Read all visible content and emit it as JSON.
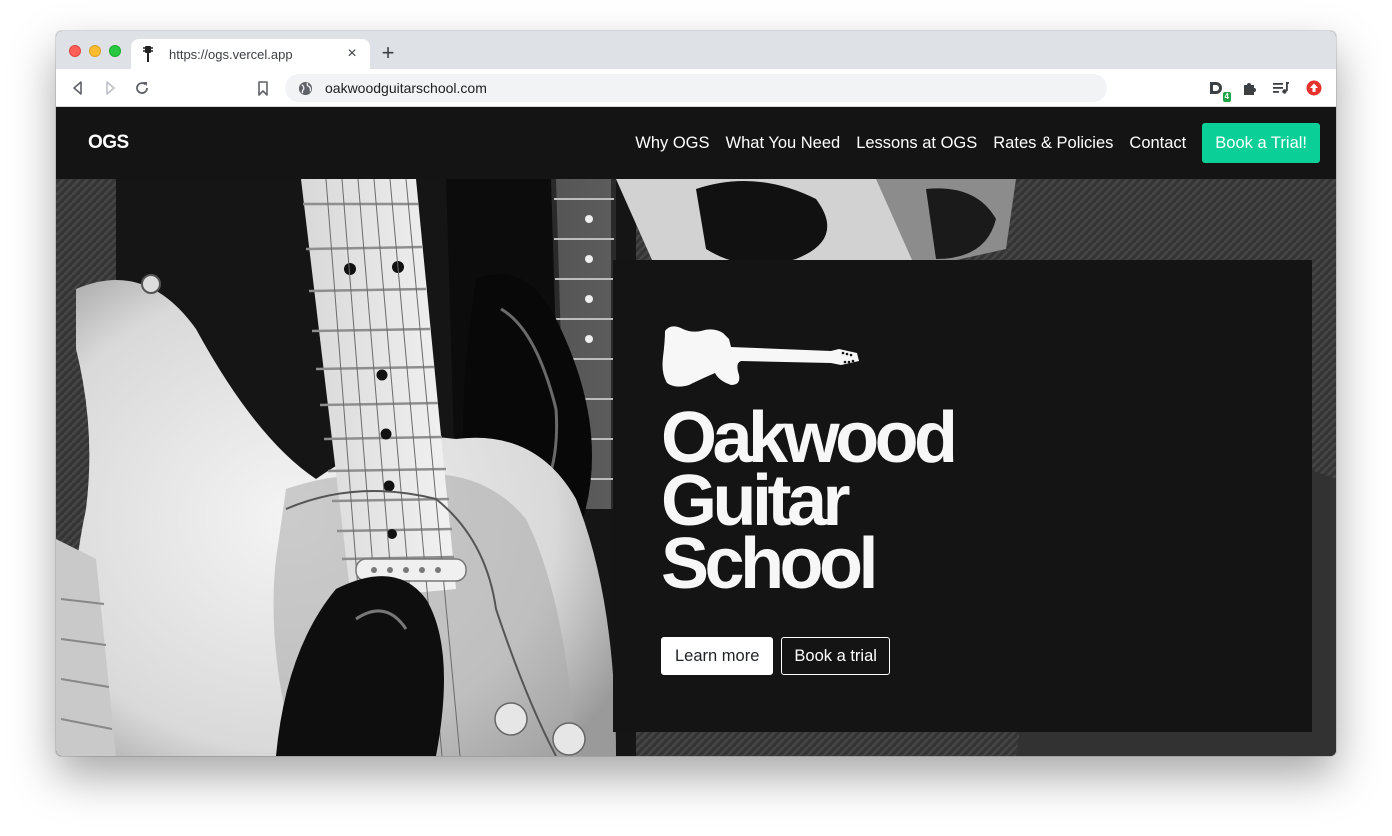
{
  "browser": {
    "tab": {
      "title": "https://ogs.vercel.app",
      "favicon": "guitar-headstock-icon",
      "close": "×"
    },
    "new_tab_label": "+",
    "toolbar": {
      "back_icon": "back-arrow-icon",
      "forward_icon": "forward-arrow-icon",
      "reload_icon": "reload-icon",
      "bookmark_icon": "bookmark-icon",
      "url": "oakwoodguitarschool.com",
      "site_info_icon": "globe-icon",
      "extensions": [
        {
          "icon": "dashlane-d-icon",
          "badge": "4"
        },
        {
          "icon": "puzzle-piece-icon"
        },
        {
          "icon": "media-queue-icon"
        },
        {
          "icon": "red-upload-circle-icon"
        }
      ]
    }
  },
  "site": {
    "brand": "OGS",
    "nav": {
      "links": [
        "Why OGS",
        "What You Need",
        "Lessons at OGS",
        "Rates & Policies",
        "Contact"
      ],
      "cta": "Book a Trial!"
    },
    "hero": {
      "logo_icon": "telecaster-guitar-icon",
      "title_lines": [
        "Oakwood",
        "Guitar",
        "School"
      ],
      "primary_button": "Learn more",
      "secondary_button": "Book a trial",
      "background": "grayscale-electric-guitars-photo"
    },
    "colors": {
      "accent": "#0acf97",
      "navbar_bg": "#141414",
      "card_bg": "#141414",
      "title_text": "#f7f7f7"
    }
  }
}
